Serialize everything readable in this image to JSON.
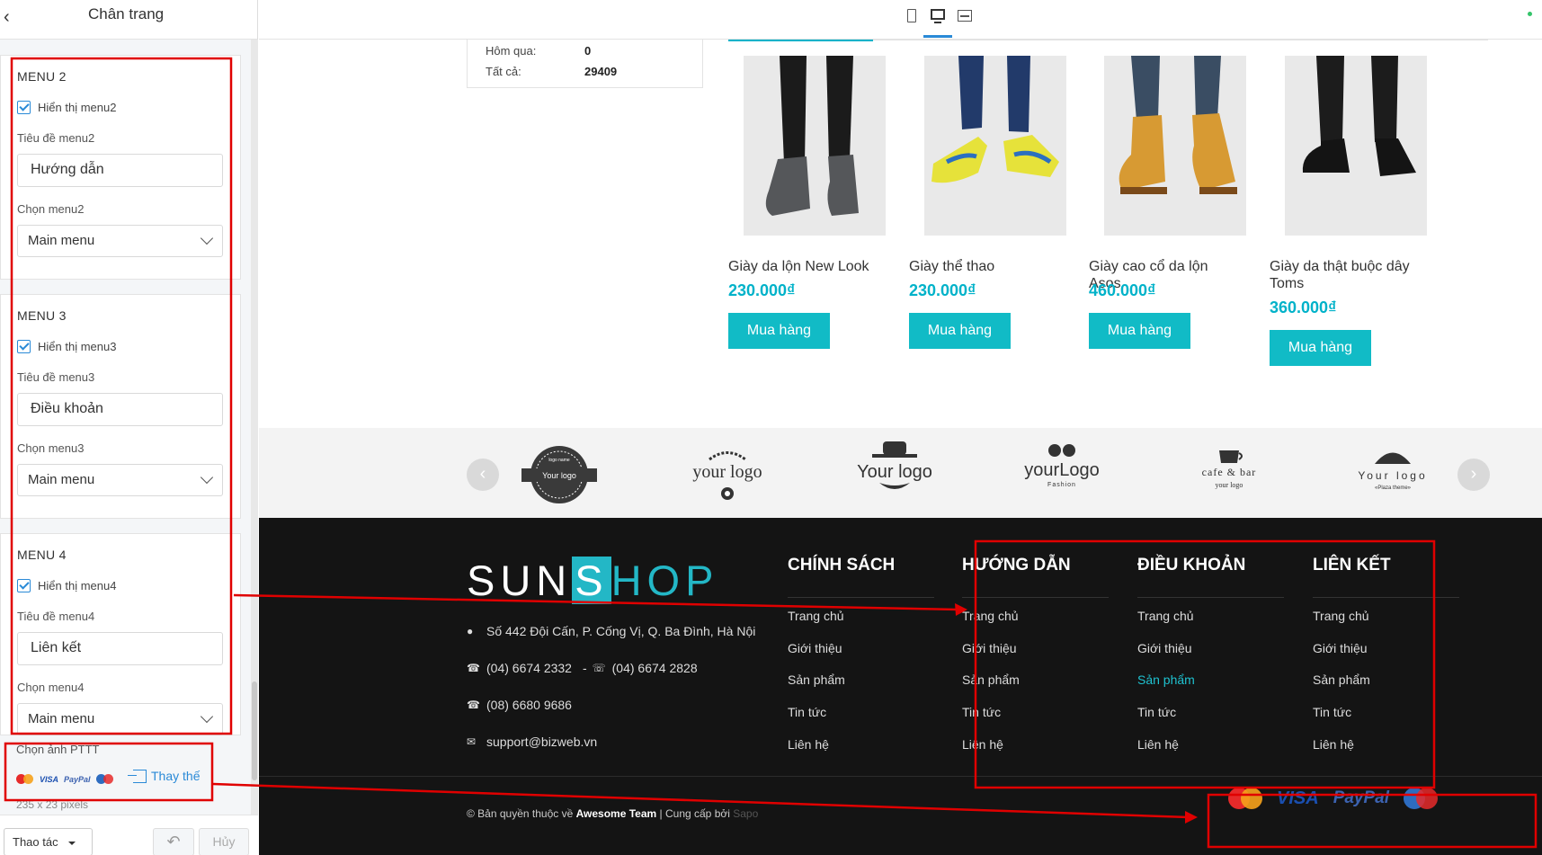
{
  "panel": {
    "title": "Chân trang",
    "menu2": {
      "heading": "MENU 2",
      "show_label": "Hiển thị menu2",
      "title_label": "Tiêu đề menu2",
      "title_value": "Hướng dẫn",
      "choose_label": "Chọn menu2",
      "choose_value": "Main menu"
    },
    "menu3": {
      "heading": "MENU 3",
      "show_label": "Hiển thị menu3",
      "title_label": "Tiêu đề menu3",
      "title_value": "Điều khoản",
      "choose_label": "Chọn menu3",
      "choose_value": "Main menu"
    },
    "menu4": {
      "heading": "MENU 4",
      "show_label": "Hiển thị menu4",
      "title_label": "Tiêu đề menu4",
      "title_value": "Liên kết",
      "choose_label": "Chọn menu4",
      "choose_value": "Main menu"
    },
    "pttt_label": "Chọn ảnh PTTT",
    "pay_mini": [
      "VISA",
      "PayPal"
    ],
    "replace_label": "Thay thế",
    "size_hint": "235 x 23 pixels",
    "action_label": "Thao tác",
    "undo_label": "↶",
    "cancel_label": "Hủy"
  },
  "stats": {
    "yesterday_label": "Hôm qua:",
    "yesterday_value": "0",
    "total_label": "Tất cả:",
    "total_value": "29409"
  },
  "products": [
    {
      "name": "Giày da lộn New Look",
      "price": "230.000₫",
      "buy": "Mua hàng"
    },
    {
      "name": "Giày thể thao",
      "price": "230.000₫",
      "buy": "Mua hàng"
    },
    {
      "name": "Giày cao cổ da lộn Asos",
      "price": "460.000₫",
      "buy": "Mua hàng"
    },
    {
      "name": "Giày da thật buộc dây Toms",
      "price": "360.000₫",
      "buy": "Mua hàng"
    }
  ],
  "brands": [
    {
      "text": "Your logo",
      "sub": "logo name"
    },
    {
      "text": "your logo",
      "sub": ""
    },
    {
      "text": "Your logo",
      "sub": ""
    },
    {
      "text": "yourLogo",
      "sub": "Fashion"
    },
    {
      "text": "cafe & bar",
      "sub": "your logo"
    },
    {
      "text": "Your logo",
      "sub": "«Plaza theme»"
    }
  ],
  "footer": {
    "logo_sun": "SUN",
    "logo_s": "S",
    "logo_hop": "HOP",
    "contacts": [
      "Số 442 Đội Cấn, P. Cống Vị, Q. Ba Đình, Hà Nội",
      "(04) 6674 2332",
      "(04) 6674 2828",
      "(08) 6680 9686",
      "support@bizweb.vn"
    ],
    "contact_sep": "-",
    "columns": [
      {
        "title": "CHÍNH SÁCH",
        "items": [
          "Trang chủ",
          "Giới thiệu",
          "Sản phẩm",
          "Tin tức",
          "Liên hệ"
        ]
      },
      {
        "title": "HƯỚNG DẪN",
        "items": [
          "Trang chủ",
          "Giới thiệu",
          "Sản phẩm",
          "Tin tức",
          "Liên hệ"
        ]
      },
      {
        "title": "ĐIỀU KHOẢN",
        "items": [
          "Trang chủ",
          "Giới thiệu",
          "Sản phẩm",
          "Tin tức",
          "Liên hệ"
        ]
      },
      {
        "title": "LIÊN KẾT",
        "items": [
          "Trang chủ",
          "Giới thiệu",
          "Sản phẩm",
          "Tin tức",
          "Liên hệ"
        ]
      }
    ],
    "copyright_pre": "© Bản quyền thuộc về ",
    "copyright_owner": "Awesome Team",
    "copyright_mid": " | Cung cấp bởi ",
    "copyright_provider": "Sapo",
    "payments": [
      "MasterCard",
      "VISA",
      "PayPal",
      "Maestro"
    ]
  },
  "colors": {
    "accent": "#00b2c9",
    "button": "#11bbc6",
    "footer_bg": "#141414",
    "annotation": "#e00000",
    "link_blue": "#2a8ad7"
  },
  "icons": [
    "back-arrow-icon",
    "tablet-icon",
    "desktop-icon",
    "fullwidth-icon",
    "location-icon",
    "phone-icon",
    "fax-icon",
    "email-icon",
    "upload-icon"
  ]
}
